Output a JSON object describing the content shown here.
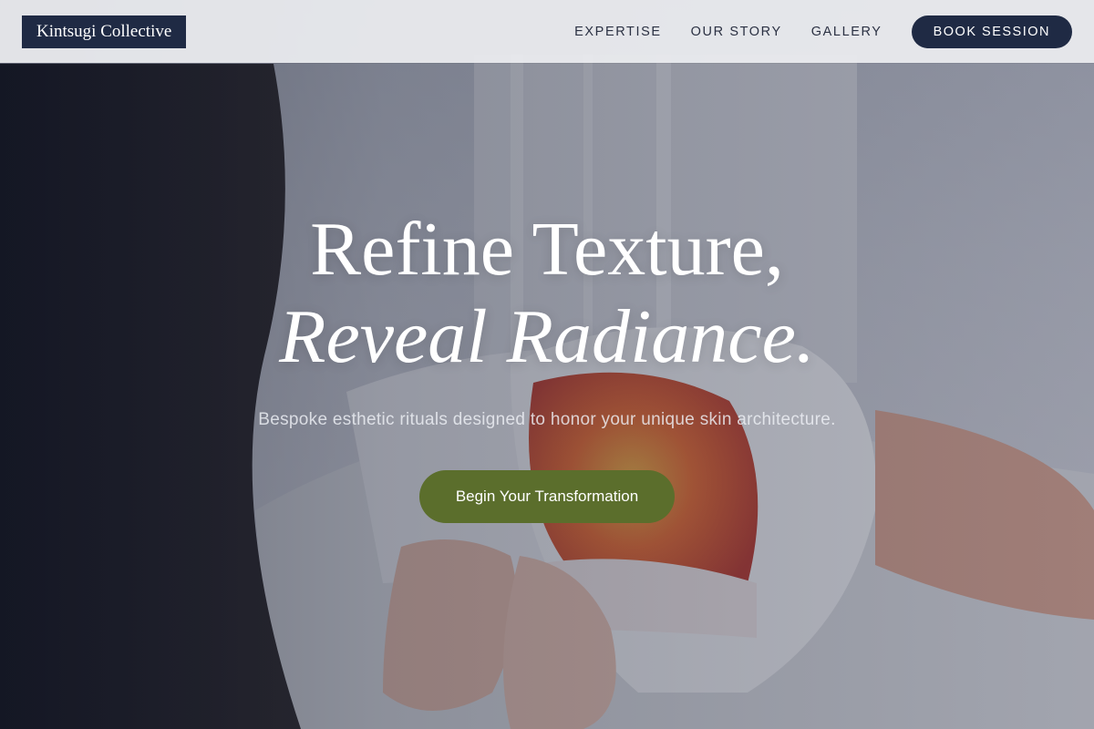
{
  "brand": {
    "name": "Kintsugi Collective"
  },
  "nav": {
    "links": [
      {
        "label": "EXPERTISE"
      },
      {
        "label": "OUR STORY"
      },
      {
        "label": "GALLERY"
      }
    ],
    "cta_label": "BOOK SESSION"
  },
  "hero": {
    "title_line1": "Refine Texture,",
    "title_line2": "Reveal Radiance.",
    "subtitle": "Bespoke esthetic rituals designed to honor your unique skin architecture.",
    "cta_label": "Begin Your Transformation"
  },
  "colors": {
    "navy": "#1f2a44",
    "olive_cta": "#5b6e2c",
    "header_bg": "#ecedf0"
  }
}
